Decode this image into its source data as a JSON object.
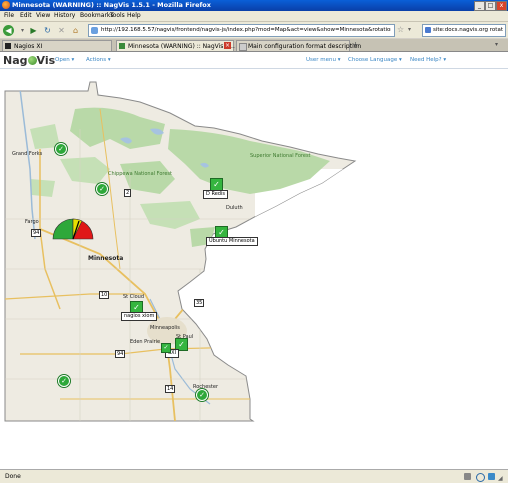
{
  "window": {
    "title": "Minnesota (WARNING) :: NagVis 1.5.1 - Mozilla Firefox",
    "min": "_",
    "max": "□",
    "close": "x"
  },
  "menu": [
    "File",
    "Edit",
    "View",
    "History",
    "Bookmarks",
    "Tools",
    "Help"
  ],
  "nav": {
    "url": "http://192.168.5.57/nagvis/frontend/nagvis-js/index.php?mod=Map&act=view&show=Minnesota&rotation=geographic",
    "search_value": "site:docs.nagvis.org rotation.pool"
  },
  "tabs": [
    {
      "label": "Nagios XI",
      "active": false
    },
    {
      "label": "Minnesota (WARNING) :: NagVis 1...",
      "active": true
    },
    {
      "label": "Main configuration format description",
      "active": false
    }
  ],
  "nagvis": {
    "logo_a": "Nag",
    "logo_b": "Vis",
    "menu_open": "Open",
    "menu_actions": "Actions",
    "menu_user": "User menu",
    "menu_language": "Choose Language",
    "menu_help": "Need Help?"
  },
  "map": {
    "cities": {
      "grand_forks": "Grand Forks",
      "duluth": "Duluth",
      "fargo": "Fargo",
      "minnesota": "Minnesota",
      "st_cloud": "St Cloud",
      "minneapolis": "Minneapolis",
      "st_paul": "St Paul",
      "eden_prairie": "Eden Prairie",
      "rochester": "Rochester",
      "superior": "Superior National Forest",
      "chippewa": "Chippewa National Forest"
    },
    "hosts": {
      "h1": "D Redis",
      "h2": "Ubuntu Minnesota",
      "h3": "nagios xiom",
      "h4": "SXI"
    },
    "roads": [
      "2",
      "94",
      "10",
      "35",
      "94",
      "14"
    ]
  },
  "status": {
    "text": "Done"
  }
}
